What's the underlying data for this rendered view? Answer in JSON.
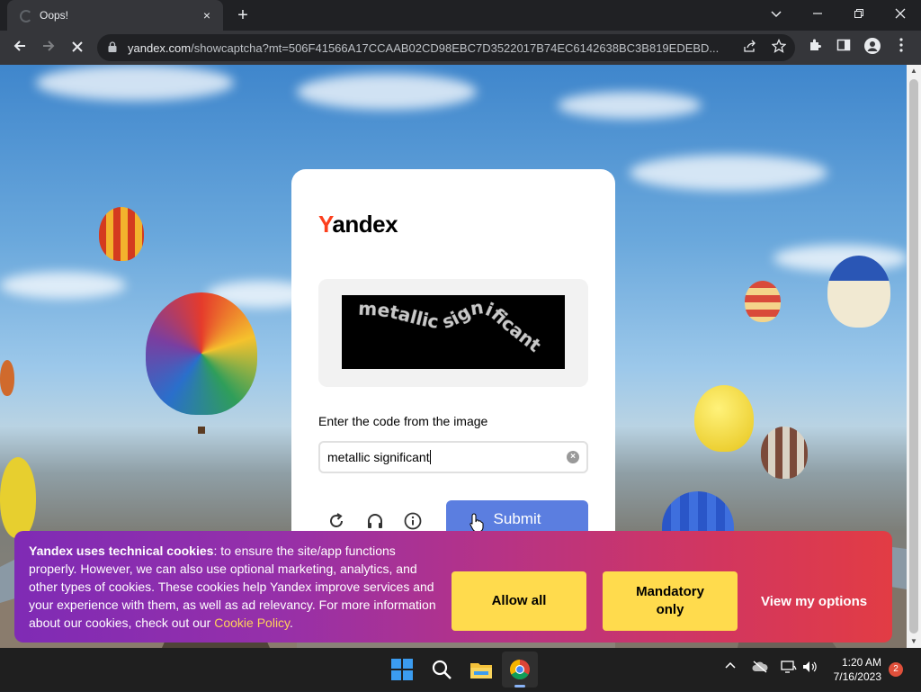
{
  "browser": {
    "tab_title": "Oops!",
    "tab_close_icon": "×",
    "new_tab_icon": "+",
    "url_host": "yandex.com",
    "url_path": "/showcaptcha?mt=506F41566A17CCAAB02CD98EBC7D3522017B74EC6142638BC3B819EDEBD..."
  },
  "captcha": {
    "logo_first": "Y",
    "logo_rest": "andex",
    "captcha_word_1": "metallic",
    "captcha_word_2": "significant",
    "prompt": "Enter the code from the image",
    "input_value": "metallic significant",
    "submit_label": "Submit"
  },
  "cookie_banner": {
    "bold_text": "Yandex uses technical cookies",
    "body_text": ": to ensure the site/app functions properly. However, we can also use optional marketing, analytics, and other types of cookies. These cookies help Yandex improve services and your experience with them, as well as ad relevancy. For more information about our cookies, check out our ",
    "link_text": "Cookie Policy",
    "trailing": ".",
    "allow_all": "Allow all",
    "mandatory_only": "Mandatory only",
    "view_options": "View my options"
  },
  "taskbar": {
    "time": "1:20 AM",
    "date": "7/16/2023",
    "notification_count": "2"
  },
  "colors": {
    "yandex_red": "#fc3f1d",
    "submit_blue": "#5b7ee0",
    "cookie_button_yellow": "#ffdb4d",
    "cookie_link_yellow": "#ffd25a"
  }
}
